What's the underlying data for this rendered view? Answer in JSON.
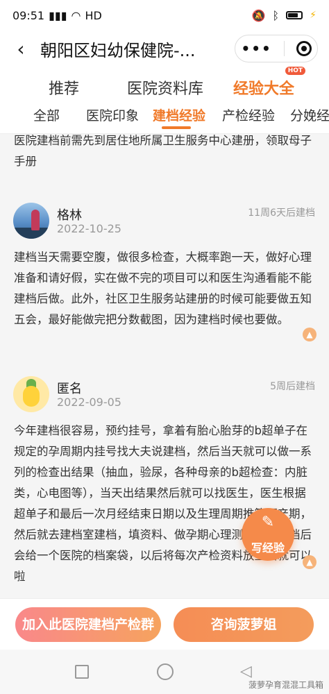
{
  "status": {
    "time": "09:51",
    "network": "HD",
    "colors": {
      "accent": "#f07a2a",
      "bolt": "#f3b400"
    }
  },
  "nav": {
    "back_icon": "chevron-left-icon",
    "title": "朝阳区妇幼保健院-..."
  },
  "main_tabs": [
    {
      "label": "推荐"
    },
    {
      "label": "医院资料库"
    },
    {
      "label": "经验大全",
      "badge": "HOT"
    }
  ],
  "sub_tabs": [
    {
      "label": "全部"
    },
    {
      "label": "医院印象"
    },
    {
      "label": "建档经验"
    },
    {
      "label": "产检经验"
    },
    {
      "label": "分娩经"
    }
  ],
  "intro_text": "医院建档前需先到居住地所属卫生服务中心建册，领取母子手册",
  "posts": [
    {
      "name": "格林",
      "date": "2022-10-25",
      "tag": "11周6天后建档",
      "text": "建档当天需要空腹，做很多检查，大概率跑一天，做好心理准备和请好假，实在做不完的项目可以和医生沟通看能不能建档后做。此外，社区卫生服务站建册的时候可能要做五知五会，最好能做完把分数截图，因为建档时候也要做。"
    },
    {
      "name": "匿名",
      "date": "2022-09-05",
      "tag": "5周后建档",
      "text": "今年建档很容易，预约挂号，拿着有胎心胎芽的b超单子在规定的孕周期内挂号找大夫说建档，然后当天就可以做一系列的检查出结果（抽血，验尿，各种母亲的b超检查：内脏类，心电图等），当天出结果然后就可以找医生，医生根据超单子和最后一次月经结束日期以及生理周期推算预产期，然后就去建档室建档，填资料、做孕期心理测试，建完档后会给一个医院的档案袋，以后将每次产检资料放里面就可以啦"
    }
  ],
  "fab": {
    "label": "写经验",
    "icon": "pencil-icon"
  },
  "bottom": {
    "join_label": "加入此医院建档产检群",
    "consult_label": "咨询菠萝姐"
  },
  "watermark": "菠萝孕育混混工具箱"
}
